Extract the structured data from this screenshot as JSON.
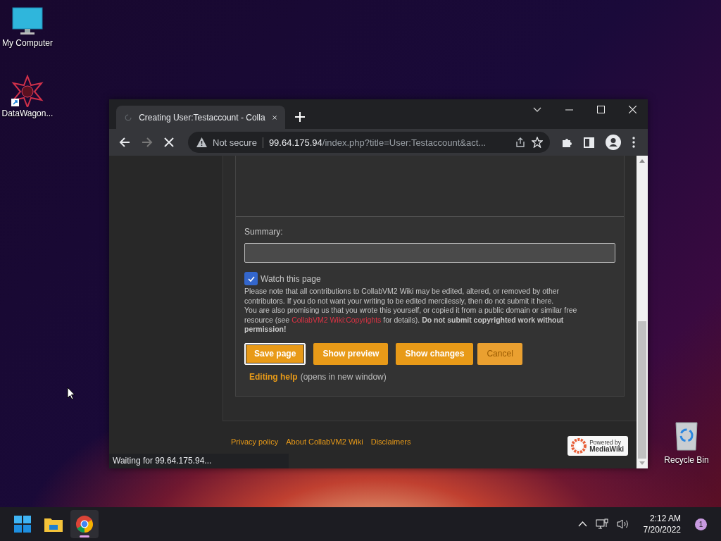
{
  "desktop_icons": [
    {
      "kind": "computer",
      "label": "My Computer"
    },
    {
      "kind": "star",
      "label": "DataWagon..."
    },
    {
      "kind": "recycle",
      "label": "Recycle Bin"
    }
  ],
  "browser": {
    "tab": {
      "title": "Creating User:Testaccount - Colla",
      "loading": true
    },
    "nav": [
      {
        "kind": "back",
        "disabled": false
      },
      {
        "kind": "forward",
        "disabled": true
      },
      {
        "kind": "stop",
        "disabled": false
      }
    ],
    "address": {
      "security": "Not secure",
      "host": "99.64.175.94",
      "path": "/index.php?title=User:Testaccount&act..."
    },
    "status": "Waiting for 99.64.175.94..."
  },
  "editor": {
    "summary_label": "Summary:",
    "watch": {
      "label": "Watch this page",
      "checked": true
    },
    "notice_1": "Please note that all contributions to CollabVM2 Wiki may be edited, altered, or removed by other contributors. If you do not want your writing to be edited mercilessly, then do not submit it here.",
    "notice_2_before": "You are also promising us that you wrote this yourself, or copied it from a public domain or similar free resource (see ",
    "notice_2_link": "CollabVM2 Wiki:Copyrights",
    "notice_2_after": " for details). **Do not submit copyrighted work without permission!**",
    "buttons": [
      {
        "label": "Save page",
        "kind": "primary",
        "focused": true
      },
      {
        "label": "Show preview",
        "kind": "primary",
        "focused": false
      },
      {
        "label": "Show changes",
        "kind": "primary",
        "focused": false
      },
      {
        "label": "Cancel",
        "kind": "cancel",
        "focused": false
      }
    ],
    "help_link": "Editing help",
    "help_note": "(opens in new window)"
  },
  "footer": {
    "links": [
      "Privacy policy",
      "About CollabVM2 Wiki",
      "Disclaimers"
    ],
    "badge_line_1": "Powered by",
    "badge_line_2": "MediaWiki"
  },
  "taskbar": {
    "apps": [
      {
        "kind": "start",
        "running": false
      },
      {
        "kind": "folder",
        "running": false
      },
      {
        "kind": "browser",
        "running": true
      }
    ],
    "time": "2:12 AM",
    "date": "7/20/2022",
    "notifications": "1"
  }
}
